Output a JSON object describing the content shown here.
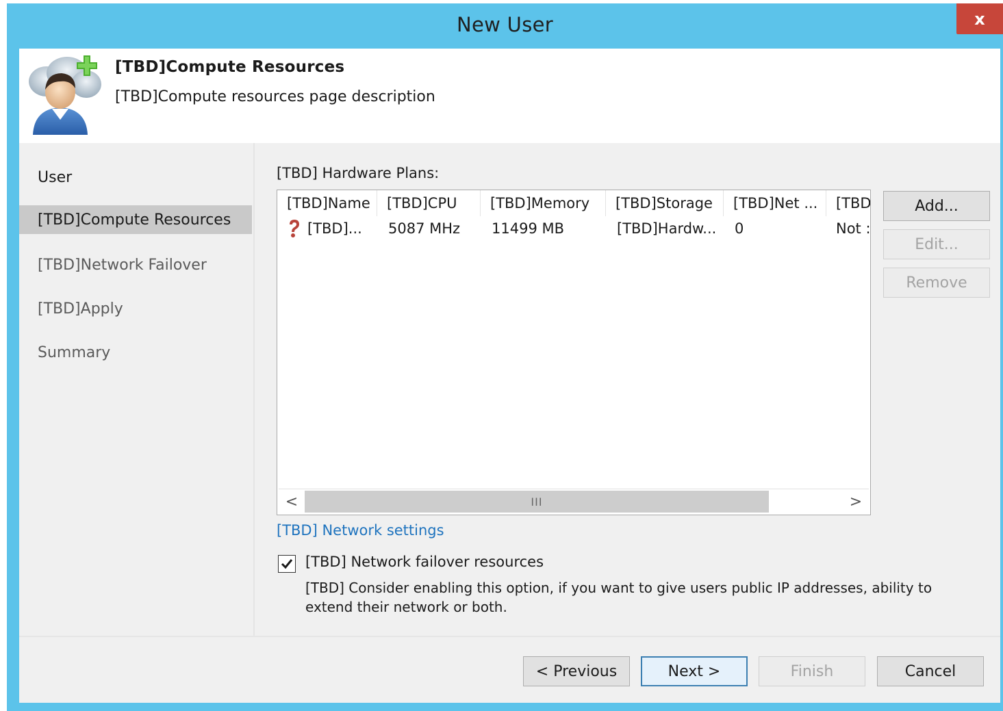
{
  "window": {
    "title": "New User",
    "close_label": "x"
  },
  "header": {
    "title": "[TBD]Compute Resources",
    "description": "[TBD]Compute resources page description",
    "icon": "user-add-icon"
  },
  "nav": {
    "items": [
      {
        "label": "User",
        "state": "done"
      },
      {
        "label": "[TBD]Compute Resources",
        "state": "active"
      },
      {
        "label": "[TBD]Network Failover",
        "state": "pending"
      },
      {
        "label": "[TBD]Apply",
        "state": "pending"
      },
      {
        "label": "Summary",
        "state": "pending"
      }
    ]
  },
  "plans": {
    "label": "[TBD] Hardware Plans:",
    "columns": [
      "[TBD]Name",
      "[TBD]CPU",
      "[TBD]Memory",
      "[TBD]Storage",
      "[TBD]Net ...",
      "[TBD"
    ],
    "rows": [
      {
        "icon": "question-icon",
        "name": "[TBD]...",
        "cpu": "5087 MHz",
        "memory": "11499 MB",
        "storage": "[TBD]Hardw...",
        "net": "0",
        "extra": "Not :"
      }
    ],
    "scroll_thumb_glyph": "III",
    "scroll_left": "<",
    "scroll_right": ">"
  },
  "side_buttons": {
    "add": "Add...",
    "edit": "Edit...",
    "remove": "Remove"
  },
  "network_link": "[TBD] Network settings",
  "failover": {
    "checked": true,
    "label": "[TBD] Network failover resources",
    "description": "[TBD] Consider enabling this option, if you want to give users public IP addresses, ability to extend their network or both."
  },
  "footer": {
    "previous": "< Previous",
    "next": "Next >",
    "finish": "Finish",
    "cancel": "Cancel"
  },
  "colors": {
    "titlebar": "#5cc3ea",
    "close": "#c7463a",
    "link": "#1e73be",
    "nav_active": "#c9c9c9"
  }
}
